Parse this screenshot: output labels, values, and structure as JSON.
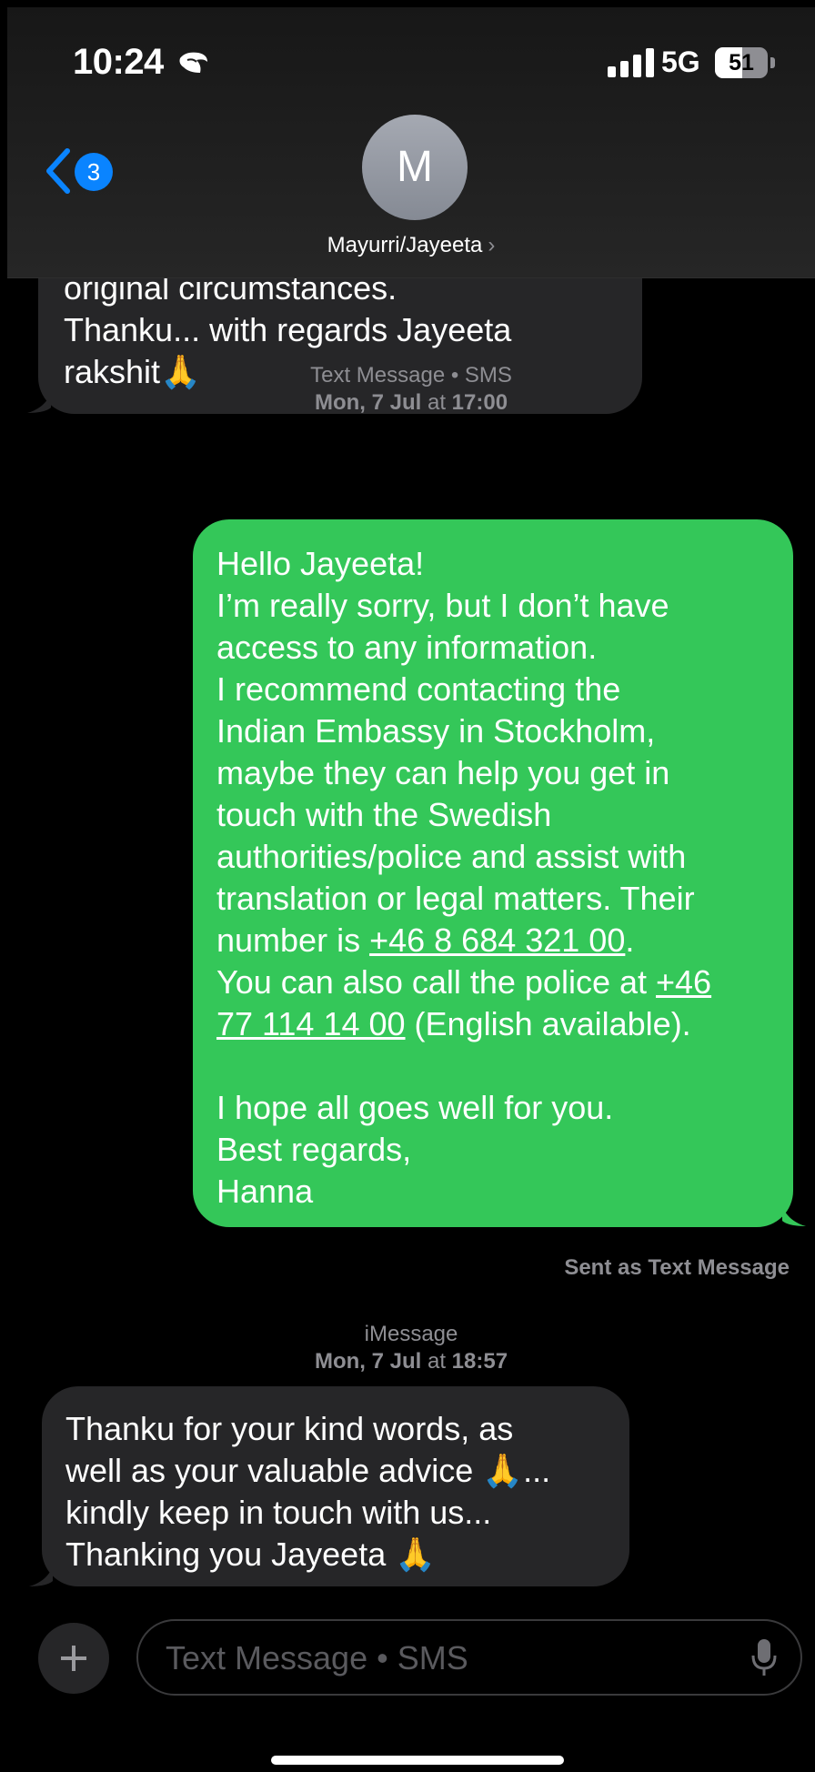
{
  "status_bar": {
    "time": "10:24",
    "network": "5G",
    "battery": "51",
    "battery_level": 0.51
  },
  "header": {
    "back_badge": "3",
    "avatar_initial": "M",
    "contact_name": "Mayurri/Jayeeta",
    "name_chevron": "›"
  },
  "messages": {
    "first": {
      "lines": [
        "original circumstances.",
        "Thanku... with regards Jayeeta",
        "rakshit🙏"
      ]
    },
    "meta1": {
      "service": "Text Message • SMS",
      "date": "Mon, 7 Jul",
      "at": "at",
      "time": "17:00"
    },
    "sent": {
      "line1": "Hello Jayeeta!",
      "line2": "I’m really sorry, but I don’t have",
      "line3": "access to any information.",
      "line4": "I recommend contacting the",
      "line5": "Indian Embassy in Stockholm,",
      "line6": "maybe they can help you get in",
      "line7": "touch with the Swedish",
      "line8": "authorities/police and assist with",
      "line9": "translation or legal matters. Their",
      "line10_prefix": "number is ",
      "embassy_number": "+46 8 684 321 00",
      "line10_suffix": ".",
      "line11_prefix": "You can also call the police at ",
      "police_number_part1": "+46",
      "police_number_part2": "77 114 14 00",
      "line12_suffix": " (English available).",
      "line13": "I hope all goes well for you.",
      "line14": "Best regards,",
      "line15": "Hanna"
    },
    "sent_note": "Sent as Text Message",
    "meta2": {
      "service": "iMessage",
      "date": "Mon, 7 Jul",
      "at": "at",
      "time": "18:57"
    },
    "last": {
      "lines": [
        "Thanku for your kind words, as",
        "well as your valuable advice 🙏...",
        "kindly keep in touch with us...",
        "Thanking you Jayeeta 🙏"
      ]
    }
  },
  "compose": {
    "placeholder": "Text Message • SMS"
  },
  "colors": {
    "sent_bubble": "#34c759",
    "received_bubble": "#262628",
    "badge": "#0a84ff"
  },
  "icons": [
    "focus-moon-icon",
    "signal-icon",
    "battery-icon",
    "back-chevron-icon",
    "chevron-right-icon",
    "plus-icon",
    "microphone-icon"
  ]
}
